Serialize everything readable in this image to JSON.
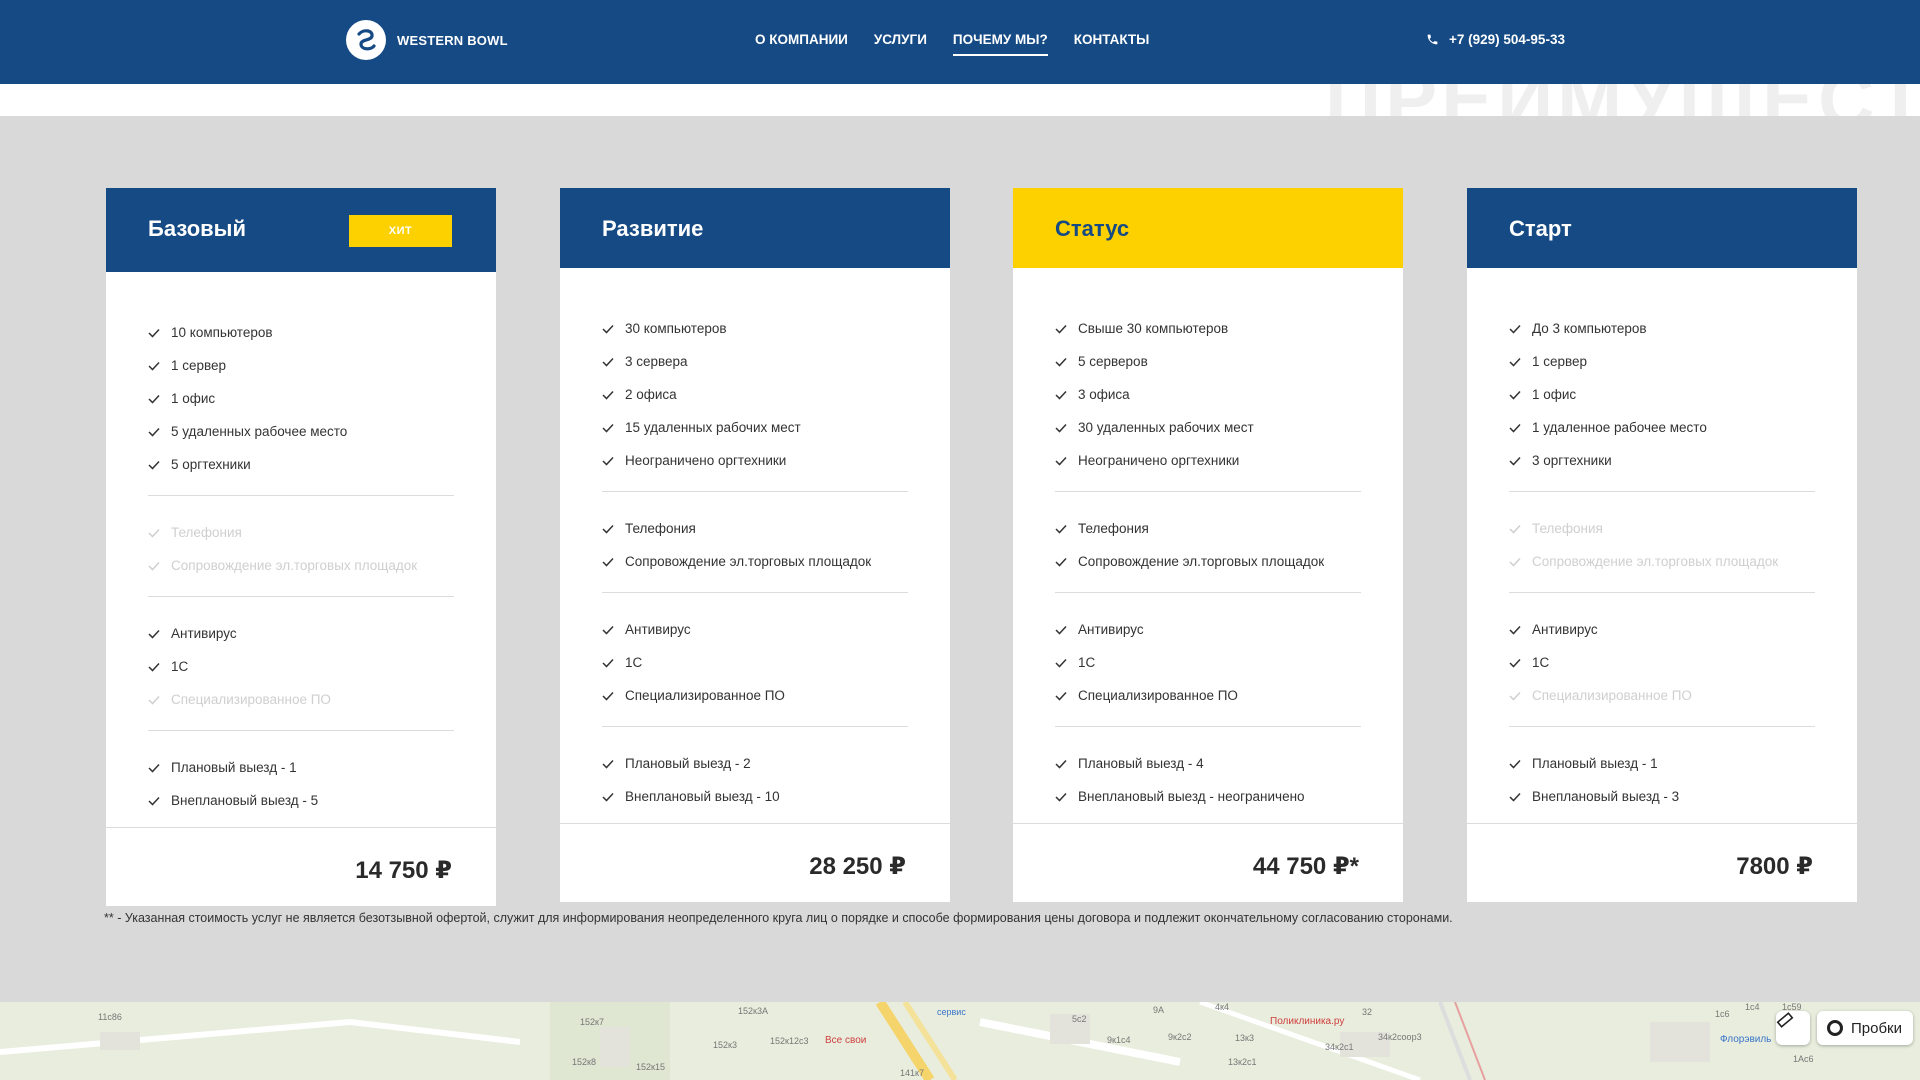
{
  "header": {
    "logo_text": "WESTERN BOWL",
    "nav": [
      "О КОМПАНИИ",
      "УСЛУГИ",
      "ПОЧЕМУ МЫ?",
      "КОНТАКТЫ"
    ],
    "active_nav": "ПОЧЕМУ МЫ?",
    "phone": "+7 (929) 504-95-33"
  },
  "ghost_heading": "ПРЕИМУЩЕСТВА",
  "colors": {
    "brand_blue": "#154a84",
    "accent_yellow": "#fdd000"
  },
  "plans": [
    {
      "title": "Базовый",
      "badge": "ХИТ",
      "groups": [
        [
          {
            "t": "10 компьютеров",
            "on": true
          },
          {
            "t": "1 сервер",
            "on": true
          },
          {
            "t": "1 офис",
            "on": true
          },
          {
            "t": "5 удаленных рабочее место",
            "on": true
          },
          {
            "t": "5 оргтехники",
            "on": true
          }
        ],
        [
          {
            "t": "Телефония",
            "on": false
          },
          {
            "t": "Сопровождение эл.торговых площадок",
            "on": false
          }
        ],
        [
          {
            "t": "Антивирус",
            "on": true
          },
          {
            "t": "1С",
            "on": true
          },
          {
            "t": "Специализированное ПО",
            "on": false
          }
        ],
        [
          {
            "t": "Плановый выезд - 1",
            "on": true
          },
          {
            "t": "Внеплановый выезд - 5",
            "on": true
          }
        ]
      ],
      "price": "14 750 ₽"
    },
    {
      "title": "Развитие",
      "badge": "",
      "groups": [
        [
          {
            "t": "30 компьютеров",
            "on": true
          },
          {
            "t": "3 сервера",
            "on": true
          },
          {
            "t": "2 офиса",
            "on": true
          },
          {
            "t": "15 удаленных рабочих мест",
            "on": true
          },
          {
            "t": "Неограничено оргтехники",
            "on": true
          }
        ],
        [
          {
            "t": "Телефония",
            "on": true
          },
          {
            "t": "Сопровождение эл.торговых площадок",
            "on": true
          }
        ],
        [
          {
            "t": "Антивирус",
            "on": true
          },
          {
            "t": "1С",
            "on": true
          },
          {
            "t": "Специализированное ПО",
            "on": true
          }
        ],
        [
          {
            "t": "Плановый выезд - 2",
            "on": true
          },
          {
            "t": "Внеплановый выезд - 10",
            "on": true
          }
        ]
      ],
      "price": "28 250 ₽"
    },
    {
      "title": "Статус",
      "badge": "",
      "groups": [
        [
          {
            "t": "Свыше 30 компьютеров",
            "on": true
          },
          {
            "t": "5 серверов",
            "on": true
          },
          {
            "t": "3 офиса",
            "on": true
          },
          {
            "t": "30 удаленных рабочих мест",
            "on": true
          },
          {
            "t": "Неограничено оргтехники",
            "on": true
          }
        ],
        [
          {
            "t": "Телефония",
            "on": true
          },
          {
            "t": "Сопровождение эл.торговых площадок",
            "on": true
          }
        ],
        [
          {
            "t": "Антивирус",
            "on": true
          },
          {
            "t": "1С",
            "on": true
          },
          {
            "t": "Специализированное ПО",
            "on": true
          }
        ],
        [
          {
            "t": "Плановый выезд - 4",
            "on": true
          },
          {
            "t": "Внеплановый выезд - неограничено",
            "on": true
          }
        ]
      ],
      "price": "44 750 ₽*"
    },
    {
      "title": "Старт",
      "badge": "",
      "groups": [
        [
          {
            "t": "До 3 компьютеров",
            "on": true
          },
          {
            "t": "1 сервер",
            "on": true
          },
          {
            "t": "1 офис",
            "on": true
          },
          {
            "t": "1 удаленное рабочее место",
            "on": true
          },
          {
            "t": "3 оргтехники",
            "on": true
          }
        ],
        [
          {
            "t": "Телефония",
            "on": false
          },
          {
            "t": "Сопровождение эл.торговых площадок",
            "on": false
          }
        ],
        [
          {
            "t": "Антивирус",
            "on": true
          },
          {
            "t": "1С",
            "on": true
          },
          {
            "t": "Специализированное ПО",
            "on": false
          }
        ],
        [
          {
            "t": "Плановый выезд - 1",
            "on": true
          },
          {
            "t": "Внеплановый выезд - 3",
            "on": true
          }
        ]
      ],
      "price": "7800 ₽"
    }
  ],
  "note": "** - Указанная стоимость услуг не является безотзывной офертой, служит для информирования неопределенного круга лиц о порядке и способе формирования цены договора и подлежит окончательному согласованию сторонами.",
  "map": {
    "labels": [
      "11с86",
      "152к7",
      "152к3А",
      "152к3",
      "152к12с3",
      "152к8",
      "152к15",
      "сервис",
      "5с2",
      "9А",
      "9к1с4",
      "9к2с2",
      "4к4",
      "13к3",
      "13к2с1",
      "32",
      "34к2с1",
      "34к2соор3",
      "1с4",
      "1с59",
      "1с6",
      "1Ас6",
      "141к7"
    ],
    "pois": [
      "Все свои",
      "Поликлиника.ру",
      "Флорэвиль"
    ],
    "traffic_label": "Пробки"
  }
}
